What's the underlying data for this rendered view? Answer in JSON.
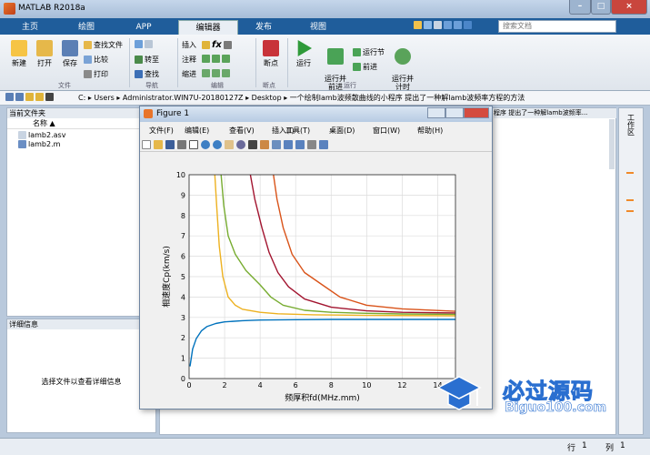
{
  "window": {
    "title": "MATLAB R2018a",
    "minimize": "–",
    "maximize": "□",
    "close": "×"
  },
  "tabs": [
    "主页",
    "绘图",
    "APP",
    "编辑器",
    "发布",
    "视图"
  ],
  "active_tab": "编辑器",
  "search": {
    "placeholder": "搜索文档"
  },
  "ribbon": {
    "file_group": {
      "new": "新建",
      "open": "打开",
      "save": "保存",
      "find_file": "查找文件",
      "compare": "比较",
      "print": "打印",
      "label": "文件"
    },
    "nav_group": {
      "goto": "转至",
      "find": "查找",
      "label": "导航"
    },
    "edit_group": {
      "insert": "插入",
      "comment": "注释",
      "indent": "缩进",
      "fx": "fx",
      "label": "编辑"
    },
    "breakpoint_group": {
      "breakpoint": "断点",
      "label": "断点"
    },
    "run_group": {
      "run": "运行",
      "run_advance": "运行并\n前进",
      "run_section": "运行节",
      "advance": "前进",
      "run_time": "运行并\n计时",
      "label": "运行"
    }
  },
  "address": [
    "C:",
    "Users",
    "Administrator.WIN7U-20180127Z",
    "Desktop",
    "一个绘制lamb波频散曲线的小程序 提出了一种解lamb波频率方程的方法"
  ],
  "current_folder": {
    "title": "当前文件夹",
    "col_name": "名称",
    "files": [
      "lamb2.asv",
      "lamb2.m"
    ]
  },
  "details": {
    "title": "详细信息",
    "hint": "选择文件以查看详细信息"
  },
  "editor_tab_text": "程序 提出了一种解lamb波频率...",
  "side_strip": "工作区",
  "status": {
    "row_label": "行",
    "row": "1",
    "col_label": "列",
    "col": "1"
  },
  "figure": {
    "title": "Figure 1",
    "menu": [
      "文件(F)",
      "编辑(E)",
      "查看(V)",
      "插入(I)",
      "工具(T)",
      "桌面(D)",
      "窗口(W)",
      "帮助(H)"
    ]
  },
  "watermark": {
    "title": "必过源码",
    "site": "Biguo100.com"
  },
  "chart_data": {
    "type": "line",
    "xlabel": "频厚积fd(MHz.mm)",
    "ylabel": "相速度Cp(km/s)",
    "xlim": [
      0,
      15
    ],
    "ylim": [
      0,
      10
    ],
    "xticks": [
      0,
      2,
      4,
      6,
      8,
      10,
      12,
      14
    ],
    "yticks": [
      0,
      1,
      2,
      3,
      4,
      5,
      6,
      7,
      8,
      9,
      10
    ],
    "grid": true,
    "series": [
      {
        "color": "#0072bd",
        "x": [
          0.05,
          0.2,
          0.4,
          0.7,
          1.0,
          1.5,
          2.0,
          3.0,
          4.0,
          6.0,
          8.0,
          10.0,
          12.0,
          15.0
        ],
        "y": [
          0.6,
          1.45,
          1.95,
          2.35,
          2.55,
          2.7,
          2.78,
          2.84,
          2.87,
          2.89,
          2.9,
          2.9,
          2.9,
          2.9
        ]
      },
      {
        "color": "#edb120",
        "x": [
          1.45,
          1.55,
          1.7,
          1.9,
          2.2,
          2.6,
          3.0,
          4.0,
          5.0,
          7.0,
          10.0,
          15.0
        ],
        "y": [
          10,
          8.5,
          6.5,
          5.0,
          4.0,
          3.6,
          3.4,
          3.25,
          3.18,
          3.13,
          3.1,
          3.08
        ]
      },
      {
        "color": "#77ac30",
        "x": [
          1.8,
          1.95,
          2.2,
          2.6,
          3.2,
          4.0,
          4.6,
          5.3,
          6.5,
          8.0,
          10.0,
          12.0,
          15.0
        ],
        "y": [
          10,
          8.5,
          7.0,
          6.1,
          5.3,
          4.6,
          4.0,
          3.6,
          3.35,
          3.25,
          3.2,
          3.17,
          3.15
        ]
      },
      {
        "color": "#a2142f",
        "x": [
          3.45,
          3.7,
          4.1,
          4.5,
          5.0,
          5.6,
          6.5,
          8.0,
          10.0,
          12.0,
          15.0
        ],
        "y": [
          10,
          8.8,
          7.4,
          6.2,
          5.2,
          4.5,
          3.9,
          3.5,
          3.32,
          3.25,
          3.22
        ]
      },
      {
        "color": "#d95319",
        "x": [
          4.75,
          4.95,
          5.3,
          5.8,
          6.5,
          7.5,
          8.5,
          10.0,
          12.0,
          15.0
        ],
        "y": [
          10,
          8.8,
          7.4,
          6.1,
          5.2,
          4.6,
          4.0,
          3.6,
          3.42,
          3.3
        ]
      }
    ]
  }
}
